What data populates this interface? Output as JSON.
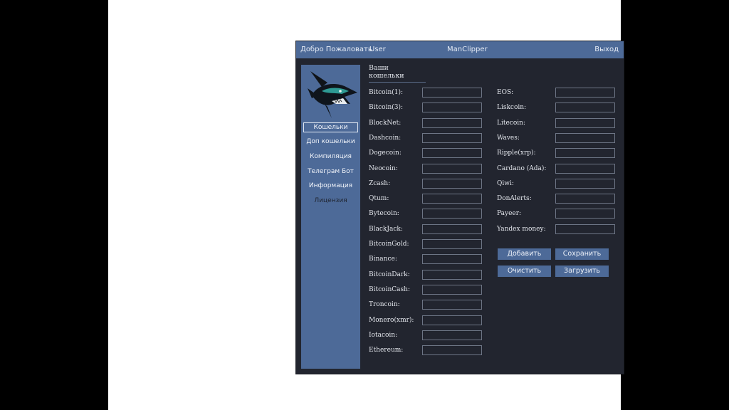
{
  "window": {
    "welcome": "Добро Пожаловать",
    "user": "User",
    "app_title": "ManClipper",
    "exit_label": "Выход"
  },
  "sidebar": {
    "logo": "shark-logo-icon",
    "items": [
      {
        "label": "Кошельки"
      },
      {
        "label": "Доп кошельки"
      },
      {
        "label": "Компиляция"
      },
      {
        "label": "Телеграм Бот"
      },
      {
        "label": "Информация"
      },
      {
        "label": "Лицензия"
      }
    ]
  },
  "main": {
    "section_title": "Ваши кошельки",
    "left_wallets": [
      {
        "label": "Bitcoin(1):",
        "value": ""
      },
      {
        "label": "Bitcoin(3):",
        "value": ""
      },
      {
        "label": "BlockNet:",
        "value": ""
      },
      {
        "label": "Dashcoin:",
        "value": ""
      },
      {
        "label": "Dogecoin:",
        "value": ""
      },
      {
        "label": "Neocoin:",
        "value": ""
      },
      {
        "label": "Zcash:",
        "value": ""
      },
      {
        "label": "Qtum:",
        "value": ""
      },
      {
        "label": "Bytecoin:",
        "value": ""
      },
      {
        "label": "BlackJack:",
        "value": ""
      },
      {
        "label": "BitcoinGold:",
        "value": ""
      },
      {
        "label": "Binance:",
        "value": ""
      },
      {
        "label": "BitcoinDark:",
        "value": ""
      },
      {
        "label": "BitcoinCash:",
        "value": ""
      },
      {
        "label": "Troncoin:",
        "value": ""
      },
      {
        "label": "Monero(xmr):",
        "value": ""
      },
      {
        "label": "Iotacoin:",
        "value": ""
      },
      {
        "label": "Ethereum:",
        "value": ""
      }
    ],
    "right_wallets": [
      {
        "label": "EOS:",
        "value": ""
      },
      {
        "label": "Liskcoin:",
        "value": ""
      },
      {
        "label": "Litecoin:",
        "value": ""
      },
      {
        "label": "Waves:",
        "value": ""
      },
      {
        "label": "Ripple(xrp):",
        "value": ""
      },
      {
        "label": "Cardano (Ada):",
        "value": ""
      },
      {
        "label": "Qiwi:",
        "value": ""
      },
      {
        "label": "DonAlerts:",
        "value": ""
      },
      {
        "label": "Payeer:",
        "value": ""
      },
      {
        "label": "Yandex money:",
        "value": ""
      }
    ],
    "buttons": {
      "add": "Добавить",
      "save": "Сохранить",
      "clear": "Очистить",
      "load": "Загрузить"
    }
  },
  "colors": {
    "accent": "#4d6a98",
    "background": "#22252f"
  }
}
